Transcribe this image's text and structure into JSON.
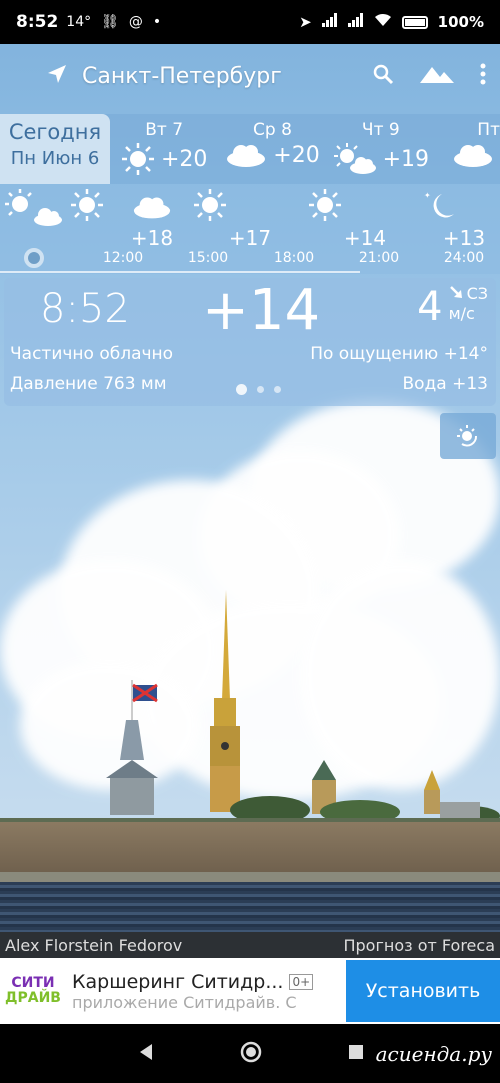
{
  "status": {
    "time": "8:52",
    "temp": "14°",
    "battery": "100%"
  },
  "toolbar": {
    "city": "Санкт-Петербург"
  },
  "days": {
    "today_label": "Сегодня",
    "today_date": "Пн Июн 6",
    "items": [
      {
        "name": "Вт 7",
        "temp": "+20",
        "icon": "sun-icon"
      },
      {
        "name": "Ср 8",
        "temp": "+20",
        "icon": "cloud-icon"
      },
      {
        "name": "Чт 9",
        "temp": "+19",
        "icon": "sun-cloud-icon"
      },
      {
        "name": "Пт",
        "temp": "",
        "icon": "cloud-icon"
      }
    ]
  },
  "hourly": {
    "temps": [
      "+18",
      "+17",
      "+14",
      "+13"
    ],
    "times": [
      "12:00",
      "15:00",
      "18:00",
      "21:00",
      "24:00"
    ]
  },
  "current": {
    "clock": "8:52",
    "temp": "+14",
    "wind_speed": "4",
    "wind_dir": "СЗ",
    "wind_unit": "м/с",
    "condition": "Частично облачно",
    "feels_like": "По ощущению +14°",
    "pressure": "Давление 763 мм",
    "water": "Вода +13"
  },
  "credits": {
    "photo": "Alex Florstein Fedorov",
    "provider": "Прогноз от Foreca"
  },
  "ad": {
    "logo_line1": "СИТИ",
    "logo_line2": "ДРАЙВ",
    "title": "Каршеринг Ситидр...",
    "age": "0+",
    "subtitle": "приложение Ситидрайв. С",
    "install": "Установить"
  },
  "watermark": "асиенда.ру",
  "colors": {
    "install_button": "#1e8ee6",
    "today_tab": "#cfe2f2"
  }
}
